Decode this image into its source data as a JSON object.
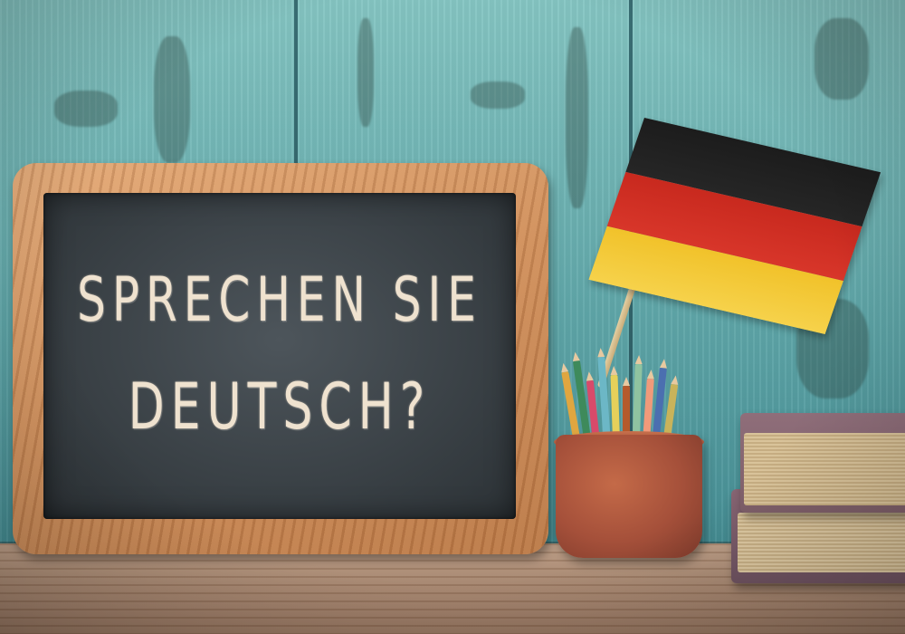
{
  "chalkboard": {
    "line1": "SPRECHEN SIE",
    "line2": "DEUTSCH?"
  },
  "flag": {
    "colors": {
      "black": "#1c1c1c",
      "red": "#d0301f",
      "gold": "#f3c935"
    }
  },
  "pencil_colors": [
    "#e0a640",
    "#3e8a5b",
    "#d84a6a",
    "#6cb7c6",
    "#e6d05a",
    "#b55a2c",
    "#8fc3a0",
    "#f09a7a",
    "#4b6fb0",
    "#c9b35a"
  ]
}
